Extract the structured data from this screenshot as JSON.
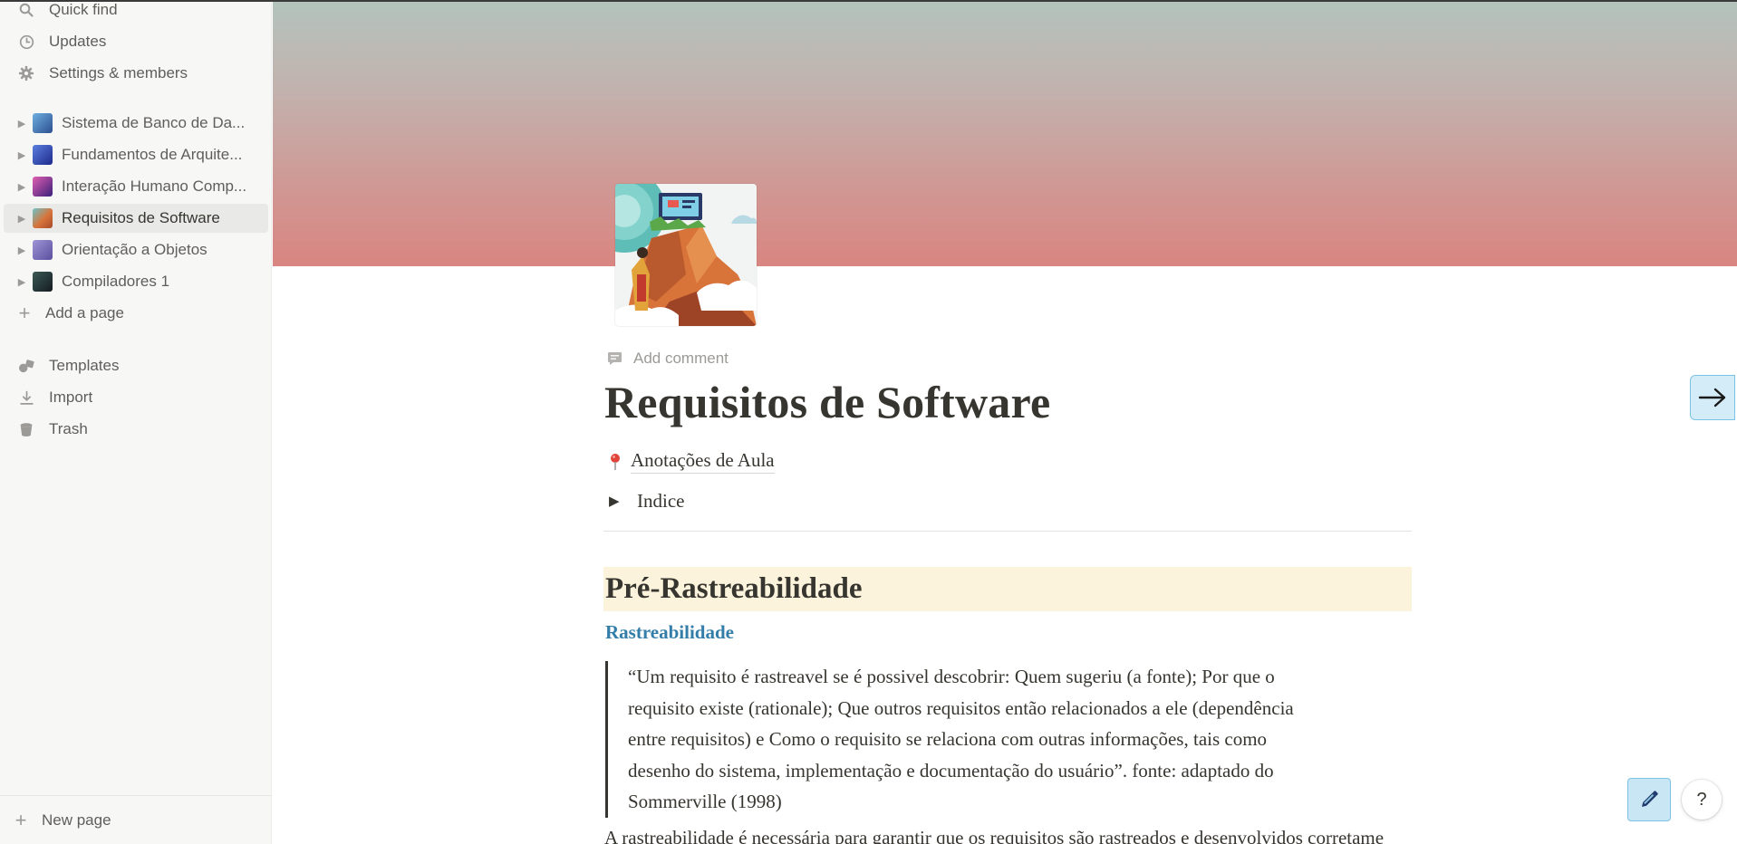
{
  "sidebar": {
    "top_items": [
      {
        "label": "Quick find",
        "icon": "search-icon"
      },
      {
        "label": "Updates",
        "icon": "clock-icon"
      },
      {
        "label": "Settings & members",
        "icon": "gear-icon"
      }
    ],
    "pages": [
      {
        "label": "Sistema de Banco de Da...",
        "thumb_color": "#3d6fb5",
        "selected": false
      },
      {
        "label": "Fundamentos de Arquite...",
        "thumb_color": "#2b3fa3",
        "selected": false
      },
      {
        "label": "Interação Humano Comp...",
        "thumb_color": "#5a2a86",
        "selected": false
      },
      {
        "label": "Requisitos de Software",
        "thumb_color": "#c4623a",
        "selected": true
      },
      {
        "label": "Orientação a Objetos",
        "thumb_color": "#7b70b8",
        "selected": false
      },
      {
        "label": "Compiladores 1",
        "thumb_color": "#24303a",
        "selected": false
      }
    ],
    "add_page": "Add a page",
    "bottom_items": [
      {
        "label": "Templates",
        "icon": "templates-icon"
      },
      {
        "label": "Import",
        "icon": "download-icon"
      },
      {
        "label": "Trash",
        "icon": "trash-icon"
      }
    ],
    "new_page": "New page"
  },
  "page": {
    "add_comment": "Add comment",
    "title": "Requisitos de Software",
    "link_label": "Anotações de Aula",
    "toggle_label": "Indice",
    "heading": "Pré-Rastreabilidade",
    "subheading": "Rastreabilidade",
    "quote_lines": [
      "“Um requisito é rastreavel se é possivel descobrir: Quem sugeriu (a fonte); Por que o",
      "requisito existe (rationale); Que outros requisitos então relacionados a ele (dependência",
      "entre requisitos) e Como o requisito se relaciona com outras informações, tais como",
      "desenho do sistema, implementação e documentação do usuário”. fonte: adaptado do",
      "Sommerville (1998)"
    ],
    "cut_text": "A rastreabilidade é necessária para garantir que os requisitos são rastreados e desenvolvidos corretamente"
  },
  "floating": {
    "help_label": "?"
  },
  "colors": {
    "sidebar_bg": "#f7f7f5",
    "heading_highlight": "#fbf3db",
    "link_blue": "#337ea9",
    "cover_top": "#b3c3bd",
    "cover_bottom": "#d98581"
  }
}
